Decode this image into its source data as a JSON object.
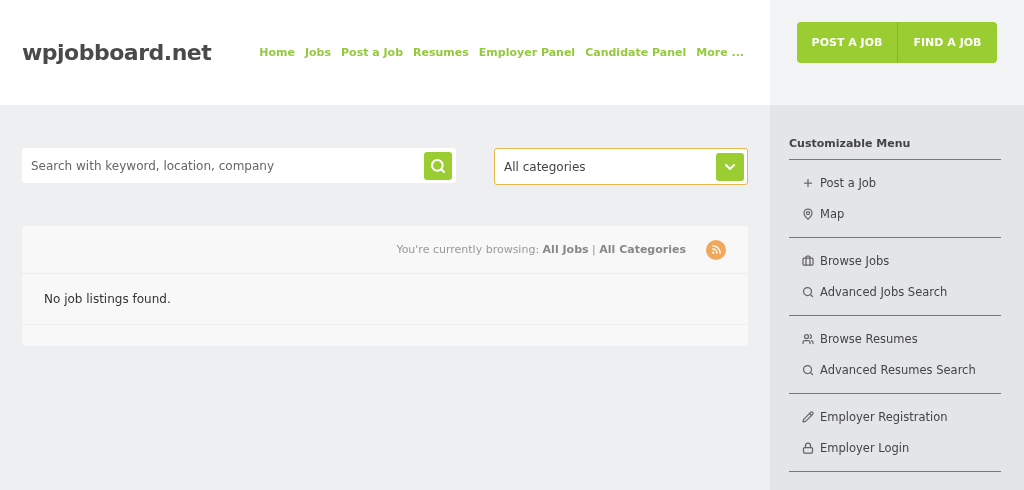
{
  "logo": "wpjobboard.net",
  "nav": [
    "Home",
    "Jobs",
    "Post a Job",
    "Resumes",
    "Employer Panel",
    "Candidate Panel",
    "More ..."
  ],
  "header_buttons": [
    "POST A JOB",
    "FIND A JOB"
  ],
  "search": {
    "placeholder": "Search with keyword, location, company"
  },
  "category_select": {
    "value": "All categories"
  },
  "browsing": "You're currently browsing: **All Jobs** | **All Categories**",
  "empty_message": "No job listings found.",
  "sidebar": {
    "title": "Customizable Menu",
    "groups": [
      [
        {
          "label": "Post a Job"
        },
        {
          "label": "Map"
        }
      ],
      [
        {
          "label": "Browse Jobs"
        },
        {
          "label": "Advanced Jobs Search"
        }
      ],
      [
        {
          "label": "Browse Resumes"
        },
        {
          "label": "Advanced Resumes Search"
        }
      ],
      [
        {
          "label": "Employer Registration"
        },
        {
          "label": "Employer Login"
        }
      ]
    ]
  }
}
